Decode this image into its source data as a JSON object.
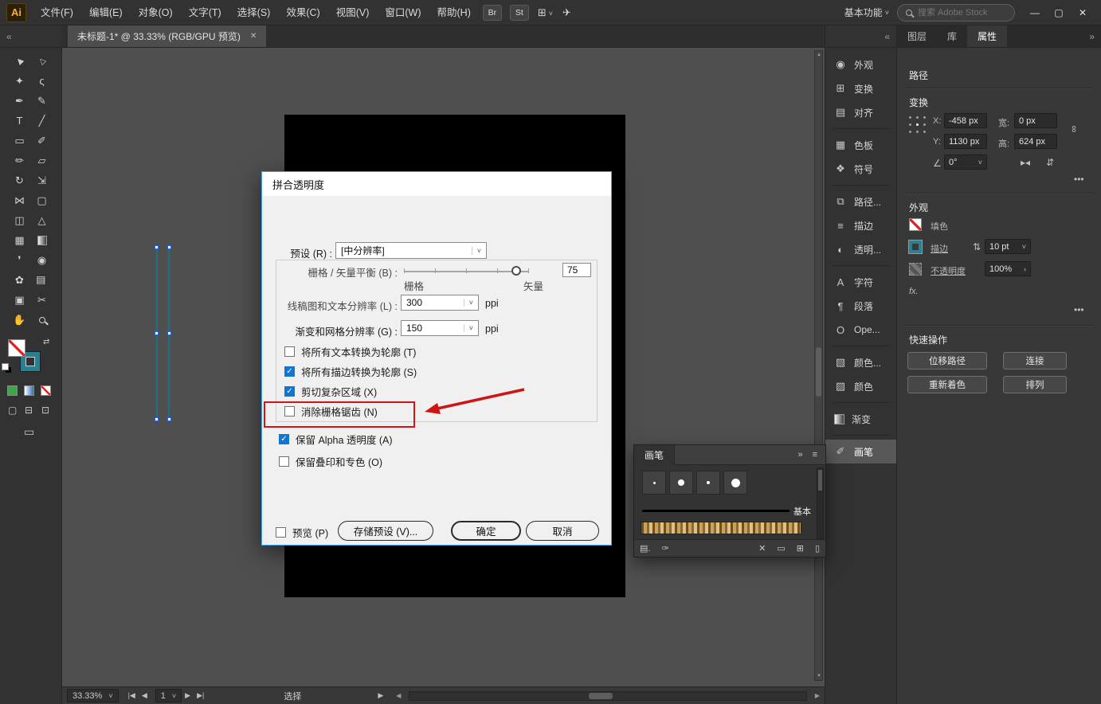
{
  "ui": {
    "caret": "˅",
    "more_dots": "•••",
    "scroll_up": "▲",
    "scroll_down": "▼",
    "scroll_left": "◀",
    "scroll_right": "▶"
  },
  "menubar": {
    "logo": "Ai",
    "items": [
      "文件(F)",
      "编辑(E)",
      "对象(O)",
      "文字(T)",
      "选择(S)",
      "效果(C)",
      "视图(V)",
      "窗口(W)",
      "帮助(H)"
    ],
    "bridge": "Br",
    "stock": "St",
    "layout_icon": "⊞",
    "share_icon": "✈",
    "workspace": "基本功能",
    "search_placeholder": "搜索 Adobe Stock",
    "window": {
      "minimize": "—",
      "maximize": "▢",
      "close": "✕"
    }
  },
  "tabbar": {
    "collapse_left": "«",
    "collapse_dock": "«",
    "expand_props": "»",
    "doc_title": "未标题-1* @ 33.33% (RGB/GPU 预览)",
    "close": "✕"
  },
  "toolbar": {
    "tools": [
      {
        "name": "selection",
        "glyph": "▶"
      },
      {
        "name": "direct-selection",
        "glyph": "▷"
      },
      {
        "name": "magic-wand",
        "glyph": "✦"
      },
      {
        "name": "lasso",
        "glyph": "ς"
      },
      {
        "name": "pen",
        "glyph": "✒"
      },
      {
        "name": "curvature",
        "glyph": "✎"
      },
      {
        "name": "type",
        "glyph": "T"
      },
      {
        "name": "line",
        "glyph": "╱"
      },
      {
        "name": "rectangle",
        "glyph": "▭"
      },
      {
        "name": "paintbrush",
        "glyph": "✐"
      },
      {
        "name": "pencil",
        "glyph": "✏"
      },
      {
        "name": "eraser",
        "glyph": "▱"
      },
      {
        "name": "rotate",
        "glyph": "↻"
      },
      {
        "name": "scale",
        "glyph": "⇲"
      },
      {
        "name": "width",
        "glyph": "⋈"
      },
      {
        "name": "free-transform",
        "glyph": "▢"
      },
      {
        "name": "shape-builder",
        "glyph": "◫"
      },
      {
        "name": "perspective-grid",
        "glyph": "△"
      },
      {
        "name": "mesh",
        "glyph": "▦"
      },
      {
        "name": "gradient",
        "glyph": ""
      },
      {
        "name": "eyedropper",
        "glyph": "❜"
      },
      {
        "name": "blend",
        "glyph": "◉"
      },
      {
        "name": "symbol-sprayer",
        "glyph": "✿"
      },
      {
        "name": "column-graph",
        "glyph": "▥"
      },
      {
        "name": "artboard",
        "glyph": "▣"
      },
      {
        "name": "slice",
        "glyph": "✂"
      },
      {
        "name": "hand",
        "glyph": "✋"
      },
      {
        "name": "zoom",
        "glyph": ""
      }
    ]
  },
  "dialog": {
    "title": "拼合透明度",
    "preset_label": "预设 (R) :",
    "preset_value": "[中分辨率]",
    "balance_label": "栅格 / 矢量平衡 (B) :",
    "balance_value": "75",
    "raster": "栅格",
    "vector": "矢量",
    "lineart_label": "线稿图和文本分辨率 (L) :",
    "lineart_value": "300",
    "lineart_unit": "ppi",
    "gradient_label": "渐变和网格分辨率 (G) :",
    "gradient_value": "150",
    "gradient_unit": "ppi",
    "checks": [
      {
        "label": "将所有文本转换为轮廓 (T)",
        "checked": false
      },
      {
        "label": "将所有描边转换为轮廓 (S)",
        "checked": true
      },
      {
        "label": "剪切复杂区域 (X)",
        "checked": true
      },
      {
        "label": "消除栅格锯齿 (N)",
        "checked": false
      }
    ],
    "alpha_check": {
      "label": "保留 Alpha 透明度 (A)",
      "checked": true
    },
    "overprint_check": {
      "label": "保留叠印和专色 (O)",
      "checked": false
    },
    "preview_label": "预览 (P)",
    "save_preset": "存储预设 (V)...",
    "ok": "确定",
    "cancel": "取消"
  },
  "dock": {
    "items": [
      {
        "label": "外观",
        "glyph": "◉"
      },
      {
        "label": "变换",
        "glyph": "⊞"
      },
      {
        "label": "对齐",
        "glyph": "▤"
      },
      {
        "label": "色板",
        "glyph": "▦"
      },
      {
        "label": "符号",
        "glyph": "❖"
      },
      {
        "label": "路径...",
        "glyph": "⧉"
      },
      {
        "label": "描边",
        "glyph": "≡"
      },
      {
        "label": "透明...",
        "glyph": "◐"
      },
      {
        "label": "字符",
        "glyph": "A"
      },
      {
        "label": "段落",
        "glyph": "¶"
      },
      {
        "label": "Ope...",
        "glyph": "O"
      },
      {
        "label": "颜色...",
        "glyph": "▧"
      },
      {
        "label": "颜色",
        "glyph": "▨"
      },
      {
        "label": "渐变",
        "glyph": ""
      },
      {
        "label": "画笔",
        "glyph": "✐"
      }
    ]
  },
  "props": {
    "tabs": [
      "图层",
      "库",
      "属性"
    ],
    "object_type": "路径",
    "transform": {
      "title": "变换",
      "x_label": "X:",
      "x_value": "-458 px",
      "y_label": "Y:",
      "y_value": "1130 px",
      "w_label": "宽:",
      "w_value": "0 px",
      "h_label": "高:",
      "h_value": "624 px",
      "angle_value": "0°"
    },
    "appearance": {
      "title": "外观",
      "fill_label": "填色",
      "stroke_label": "描边",
      "stroke_value": "10 pt",
      "opacity_label": "不透明度",
      "opacity_value": "100%",
      "fx": "fx."
    },
    "quick": {
      "title": "快速操作",
      "b1": "位移路径",
      "b2": "连接",
      "b3": "重新着色",
      "b4": "排列"
    },
    "icons": {
      "link": "∞",
      "stepper": "⇅",
      "flip_h": "▸◂",
      "flip_v": "⇵",
      "angle": "∠",
      "opacity_arrow": "›"
    }
  },
  "brushes": {
    "title": "画笔",
    "expand": "»",
    "menu": "≡",
    "basic_label": "基本",
    "dot_sizes": [
      3,
      8,
      4,
      11
    ],
    "footer": {
      "libraries": "▤.",
      "strokes": "✑",
      "remove": "✕",
      "options": "▭",
      "new": "⊞",
      "trash": "▯"
    }
  },
  "statusbar": {
    "zoom": "33.33%",
    "artboard": "1",
    "status": "选择",
    "nav_first": "|◀",
    "nav_prev": "◀",
    "nav_next": "▶",
    "nav_last": "▶|",
    "options_arrow": "▶"
  }
}
